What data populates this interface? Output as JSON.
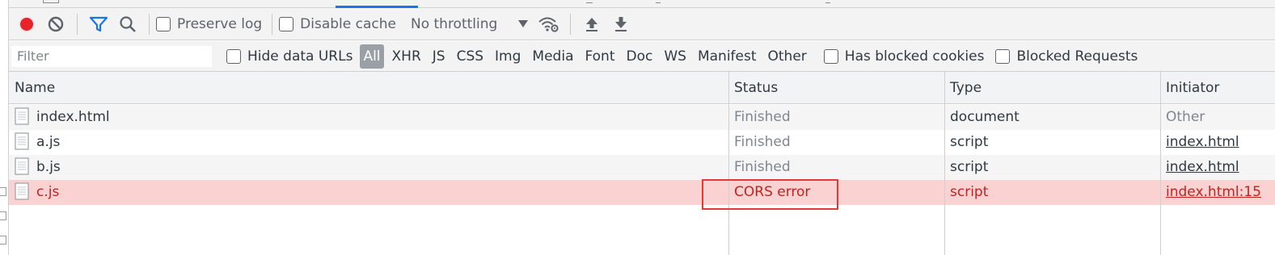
{
  "toolbar": {
    "record_icon": "record-icon",
    "clear_icon": "clear-icon",
    "filter_icon": "filter-icon",
    "search_icon": "search-icon",
    "preserve_log_label": "Preserve log",
    "preserve_log_checked": false,
    "disable_cache_label": "Disable cache",
    "disable_cache_checked": false,
    "throttling_value": "No throttling",
    "network_conditions_icon": "wifi-settings-icon",
    "import_icon": "upload-icon",
    "export_icon": "download-icon",
    "record_color": "#e8222a",
    "filter_color": "#1a73e8"
  },
  "filterbar": {
    "filter_placeholder": "Filter",
    "filter_value": "",
    "hide_data_urls_label": "Hide data URLs",
    "types": [
      "All",
      "XHR",
      "JS",
      "CSS",
      "Img",
      "Media",
      "Font",
      "Doc",
      "WS",
      "Manifest",
      "Other"
    ],
    "active_type": "All",
    "has_blocked_cookies_label": "Has blocked cookies",
    "blocked_requests_label": "Blocked Requests"
  },
  "table": {
    "columns": [
      "Name",
      "Status",
      "Type",
      "Initiator"
    ],
    "rows": [
      {
        "name": "index.html",
        "status": "Finished",
        "type": "document",
        "initiator": "Other",
        "initiator_link": false,
        "error": false
      },
      {
        "name": "a.js",
        "status": "Finished",
        "type": "script",
        "initiator": "index.html",
        "initiator_link": true,
        "error": false
      },
      {
        "name": "b.js",
        "status": "Finished",
        "type": "script",
        "initiator": "index.html",
        "initiator_link": true,
        "error": false
      },
      {
        "name": "c.js",
        "status": "CORS error",
        "type": "script",
        "initiator": "index.html:15",
        "initiator_link": true,
        "error": true
      }
    ],
    "error_row_color": "#fad2d2",
    "error_text_color": "#c5221f",
    "highlight_color": "#e53935"
  }
}
